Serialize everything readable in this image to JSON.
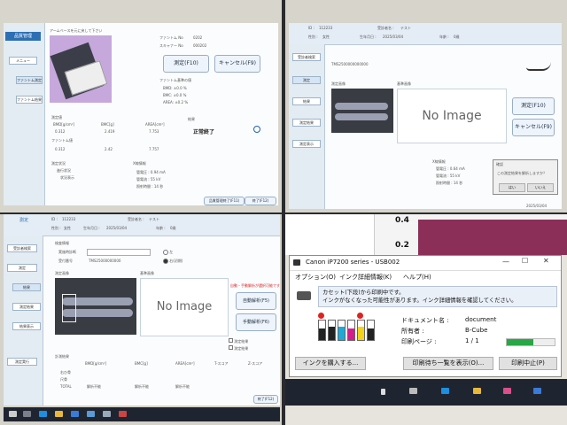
{
  "q1": {
    "nav_title": "品質管理",
    "nav_items": [
      "メニュー",
      "ファントム測定",
      "ファントム結果"
    ],
    "instruction": "アームベースを元に戻して下さい",
    "phantom_no_label": "ファントム No",
    "phantom_no_value": "0202",
    "scanner_no_label": "スキャナー No",
    "scanner_no_value": "000202",
    "measure_button": "測定(F10)",
    "cancel_button": "キャンセル(F9)",
    "criteria_title": "ファントム基準の値",
    "criteria_lines": [
      "BMD: ±0.0 %",
      "BMC: ±0.0 %",
      "AREA: ±0.2 %"
    ],
    "measured_label": "測定値",
    "cols": [
      "BMD[g/cm²]",
      "BMC[g]",
      "AREA[cm²]"
    ],
    "row1": [
      "0.312",
      "2.419",
      "7.753"
    ],
    "phantom_value_label": "ファントム値",
    "row2": [
      "0.312",
      "2.42",
      "7.757"
    ],
    "result_label": "結果",
    "result_value": "正常終了",
    "status_label": "測定状況",
    "status_lines": [
      "進行状況",
      "状況表示"
    ],
    "xray_label": "X線情報",
    "xray_lines": [
      "管電圧 : 0.94 mA",
      "管電流 : 55 kV",
      "照射時間 : 14 秒"
    ],
    "footer_buttons": [
      "品質管理終了(F11)",
      "終了(F12)"
    ]
  },
  "q2": {
    "id_label": "ID :",
    "id_value": "112233",
    "name_label": "受診者名 :",
    "name_value": "テスト",
    "sex_label": "性別 :",
    "sex_value": "女性",
    "birth_label": "生年月日 :",
    "birth_value": "2025/03/04",
    "age_label": "年齢 :",
    "age_value": "0歳",
    "exam_id": "TMS2500000000000",
    "nav_items": [
      "受診者検索",
      "測定",
      "結果",
      "測定結果",
      "測定表示"
    ],
    "measure_button": "測定(F10)",
    "cancel_button": "キャンセル(F9)",
    "bone_label": "測定画像",
    "base_label": "基準画像",
    "no_image": "No Image",
    "xray_label": "X線情報",
    "xray_lines": [
      "管電圧 : 0.64 mA",
      "管電流 : 55 kV",
      "照射時間 : 14 秒"
    ],
    "dialog_title": "確認",
    "dialog_text": "この測定結果を解析しますか？",
    "dialog_buttons": [
      "はい",
      "いいえ"
    ],
    "date_text": "2025/03/04"
  },
  "q3": {
    "id_label": "ID :",
    "id_value": "112233",
    "name_label": "受診者名 :",
    "name_value": "テスト",
    "sex_label": "性別 :",
    "sex_value": "女性",
    "birth_label": "生年月日 :",
    "birth_value": "2025/03/04",
    "age_label": "年齢 :",
    "age_value": "0歳",
    "title": "測定",
    "nav_items": [
      "受診者検索",
      "測定",
      "結果",
      "測定結果",
      "結果表示",
      "測定実行"
    ],
    "info_title": "検査情報",
    "field1_label": "実施時診断",
    "field2_label": "受付番号",
    "field2_value": "TMS25000000000",
    "radio_options": [
      "左",
      "右(初期)"
    ],
    "bone_label": "測定画像",
    "base_label": "基準画像",
    "no_image": "No Image",
    "warn_text": "自動・手動解析が選択可能です",
    "auto_button": "自動解析(F5)",
    "manual_button": "手動解析(F6)",
    "check_options": [
      "測定結果",
      "測定結果"
    ],
    "result_title": "計測結果",
    "cols": [
      "BMD[g/cm²]",
      "BMC[g]",
      "AREA[cm²]",
      "T-スコア",
      "Z-スコア"
    ],
    "rows": [
      "右ひ骨",
      "尺骨",
      "TOTAL"
    ],
    "cell_value": "解析不能",
    "footer": "終了(F12)"
  },
  "printer": {
    "title": "Canon iP7200 series - USB002",
    "menu": [
      "オプション(O)",
      "インク詳細情報(K)",
      "ヘルプ(H)"
    ],
    "message": "カセット(下段)から印刷中です。\nインクがなくなった可能性があります。インク詳細情報を確認してください。",
    "doc_label": "ドキュメント名 :",
    "doc_value": "document",
    "owner_label": "所有者 :",
    "owner_value": "B-Cube",
    "pages_label": "印刷ページ :",
    "pages_value": "1 / 1",
    "progress": 0.55,
    "buttons": [
      "インクを購入する...",
      "印刷待ち一覧を表示(O)...",
      "印刷中止(P)"
    ],
    "ink_colors": [
      "#222222",
      "#222222",
      "#1fa8d8",
      "#d81b8c",
      "#f2d21a",
      "#222222"
    ],
    "accent": "#28a745"
  },
  "excel": {
    "tick1": "0.4",
    "tick2": "0.2"
  }
}
